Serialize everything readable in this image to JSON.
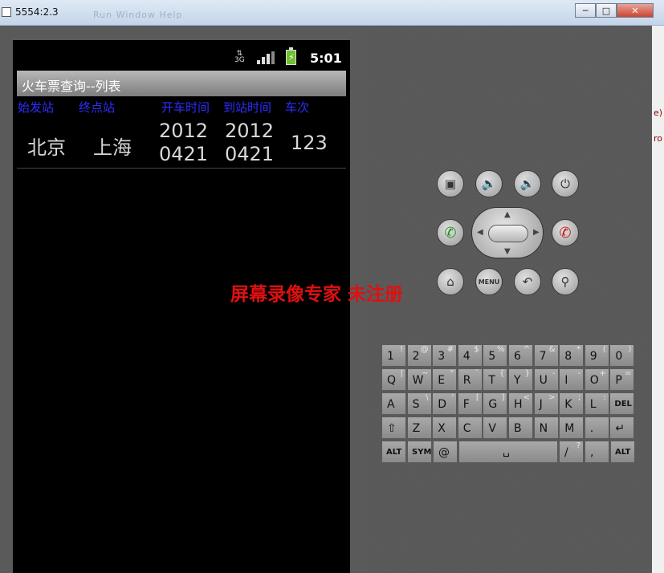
{
  "window": {
    "title": "5554:2.3",
    "menu_ghost": "Run  Window  Help"
  },
  "status_bar": {
    "network": "3G",
    "time": "5:01"
  },
  "app": {
    "title": "火车票查询--列表",
    "columns": [
      "始发站",
      "终点站",
      "开车时间",
      "到站时间",
      "车次"
    ],
    "rows": [
      {
        "from": "北京",
        "to": "上海",
        "depart_line1": "2012",
        "depart_line2": "0421",
        "arrive_line1": "2012",
        "arrive_line2": "0421",
        "train": "123"
      }
    ]
  },
  "watermark": "屏幕录像专家   未注册",
  "controls": {
    "menu_label": "MENU",
    "icons": [
      "camera-icon",
      "volume-down-icon",
      "volume-up-icon",
      "power-icon",
      "call-icon",
      "end-call-icon",
      "home-icon",
      "back-icon",
      "search-icon"
    ]
  },
  "keyboard": {
    "row1": [
      [
        "1",
        "!"
      ],
      [
        "2",
        "@"
      ],
      [
        "3",
        "#"
      ],
      [
        "4",
        "$"
      ],
      [
        "5",
        "%"
      ],
      [
        "6",
        "^"
      ],
      [
        "7",
        "&"
      ],
      [
        "8",
        "*"
      ],
      [
        "9",
        "("
      ],
      [
        "0",
        ")"
      ]
    ],
    "row2": [
      [
        "Q",
        "|"
      ],
      [
        "W",
        "~"
      ],
      [
        "E",
        "\""
      ],
      [
        "R",
        "`"
      ],
      [
        "T",
        "{"
      ],
      [
        "Y",
        "}"
      ],
      [
        "U",
        "-"
      ],
      [
        "I",
        "-"
      ],
      [
        "O",
        "+"
      ],
      [
        "P",
        "="
      ]
    ],
    "row3": [
      [
        "A",
        ""
      ],
      [
        "S",
        "\\"
      ],
      [
        "D",
        "'"
      ],
      [
        "F",
        "["
      ],
      [
        "G",
        "]"
      ],
      [
        "H",
        "<"
      ],
      [
        "J",
        ">"
      ],
      [
        "K",
        ";"
      ],
      [
        "L",
        ":"
      ],
      [
        "DEL",
        ""
      ]
    ],
    "row4": [
      [
        "⇧",
        ""
      ],
      [
        "Z",
        ""
      ],
      [
        "X",
        ""
      ],
      [
        "C",
        ""
      ],
      [
        "V",
        ""
      ],
      [
        "B",
        ""
      ],
      [
        "N",
        ""
      ],
      [
        "M",
        ""
      ],
      [
        ".",
        ""
      ],
      [
        "↵",
        ""
      ]
    ],
    "row5": {
      "alt_left": "ALT",
      "sym": "SYM",
      "at": "@",
      "slash": "/",
      "slash_alt": "?",
      "comma": ",",
      "alt_right": "ALT"
    }
  }
}
